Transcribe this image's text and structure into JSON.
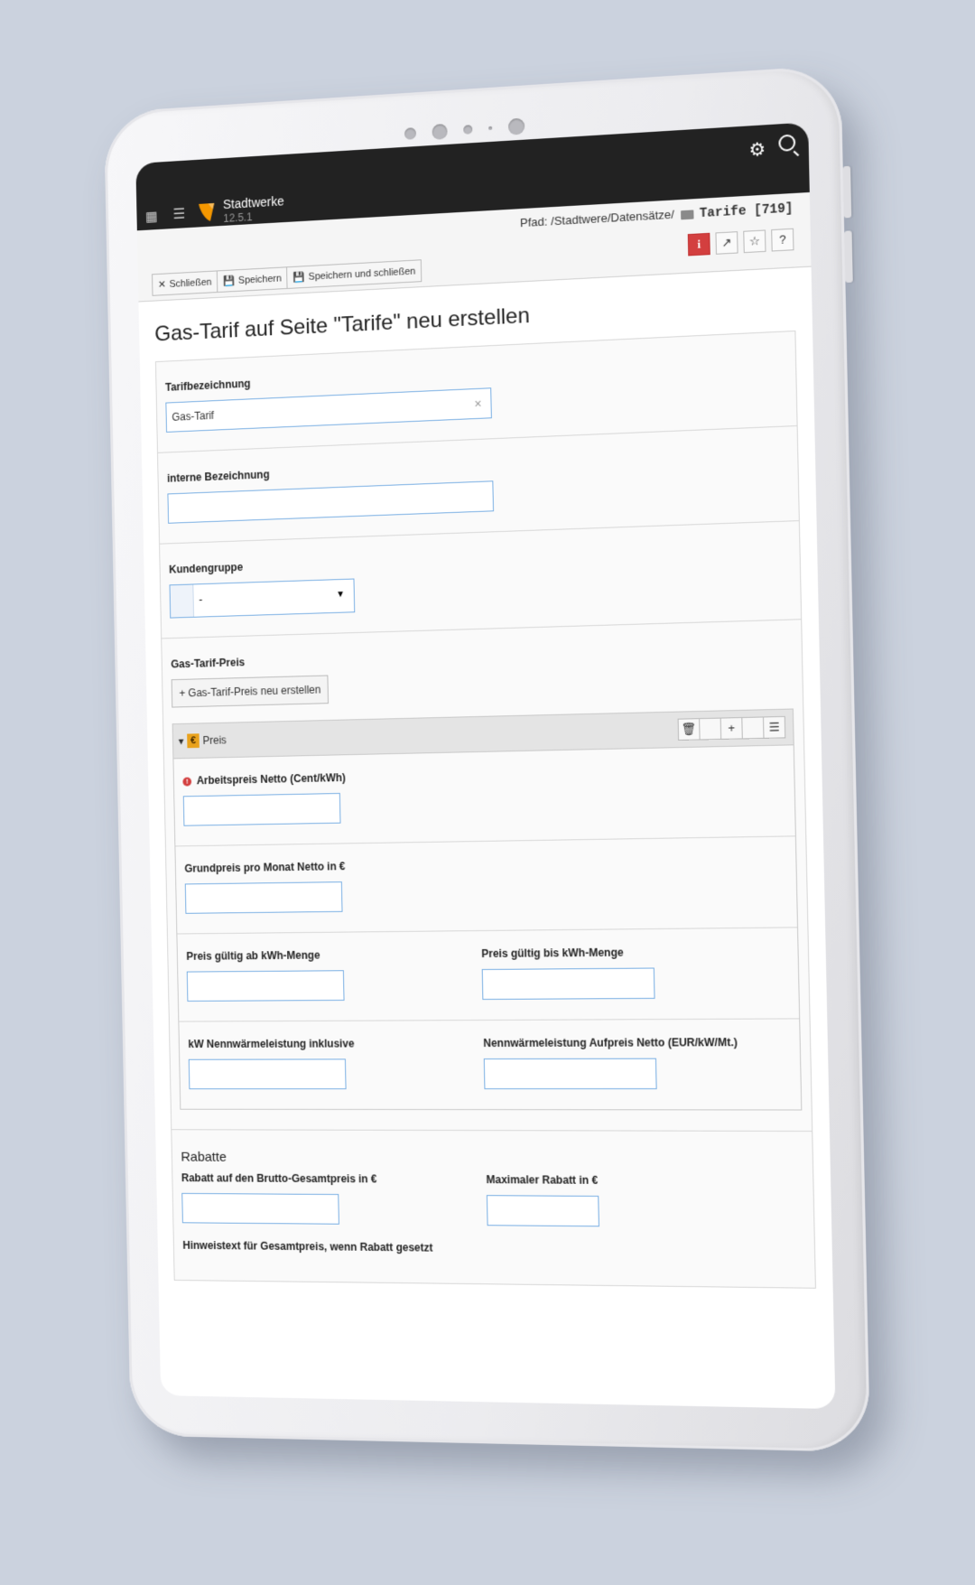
{
  "topbar": {
    "brand_name": "Stadtwerke",
    "version": "12.5.1",
    "icons": [
      "app-grid-icon",
      "list-icon",
      "typo3-logo",
      "gear-icon",
      "search-icon"
    ]
  },
  "docheader": {
    "path_label": "Pfad: /Stadtwere/Datensätze/",
    "page_name": "Tarife [719]",
    "buttons": {
      "close": "Schließen",
      "save": "Speichern",
      "save_close": "Speichern und schließen"
    },
    "icon_buttons": {
      "info": "i",
      "help": "?"
    },
    "colors": {
      "info": "#d33f3f",
      "topbar": "#222222"
    }
  },
  "page_title": "Gas-Tarif auf Seite \"Tarife\" neu erstellen",
  "form": {
    "tarifbezeichnung": {
      "label": "Tarifbezeichnung",
      "value": "Gas-Tarif"
    },
    "interne_bezeichnung": {
      "label": "interne Bezeichnung",
      "value": ""
    },
    "kundengruppe": {
      "label": "Kundengruppe",
      "selected": "-"
    },
    "gas_tarif_preis": {
      "label": "Gas-Tarif-Preis",
      "create_button": "Gas-Tarif-Preis neu erstellen",
      "inline_title": "Preis",
      "fields": {
        "arbeitspreis": "Arbeitspreis Netto (Cent/kWh)",
        "grundpreis": "Grundpreis pro Monat Netto in €",
        "preis_ab": "Preis gültig ab kWh-Menge",
        "preis_bis": "Preis gültig bis kWh-Menge",
        "kw_inklusive": "kW Nennwärmeleistung inklusive",
        "aufpreis": "Nennwärmeleistung Aufpreis Netto (EUR/kW/Mt.)"
      }
    },
    "rabatte": {
      "title": "Rabatte",
      "rabatt_brutto": "Rabatt auf den Brutto-Gesamtpreis in €",
      "max_rabatt": "Maximaler Rabatt in €",
      "hinweistext": "Hinweistext für Gesamtpreis, wenn Rabatt gesetzt"
    }
  }
}
